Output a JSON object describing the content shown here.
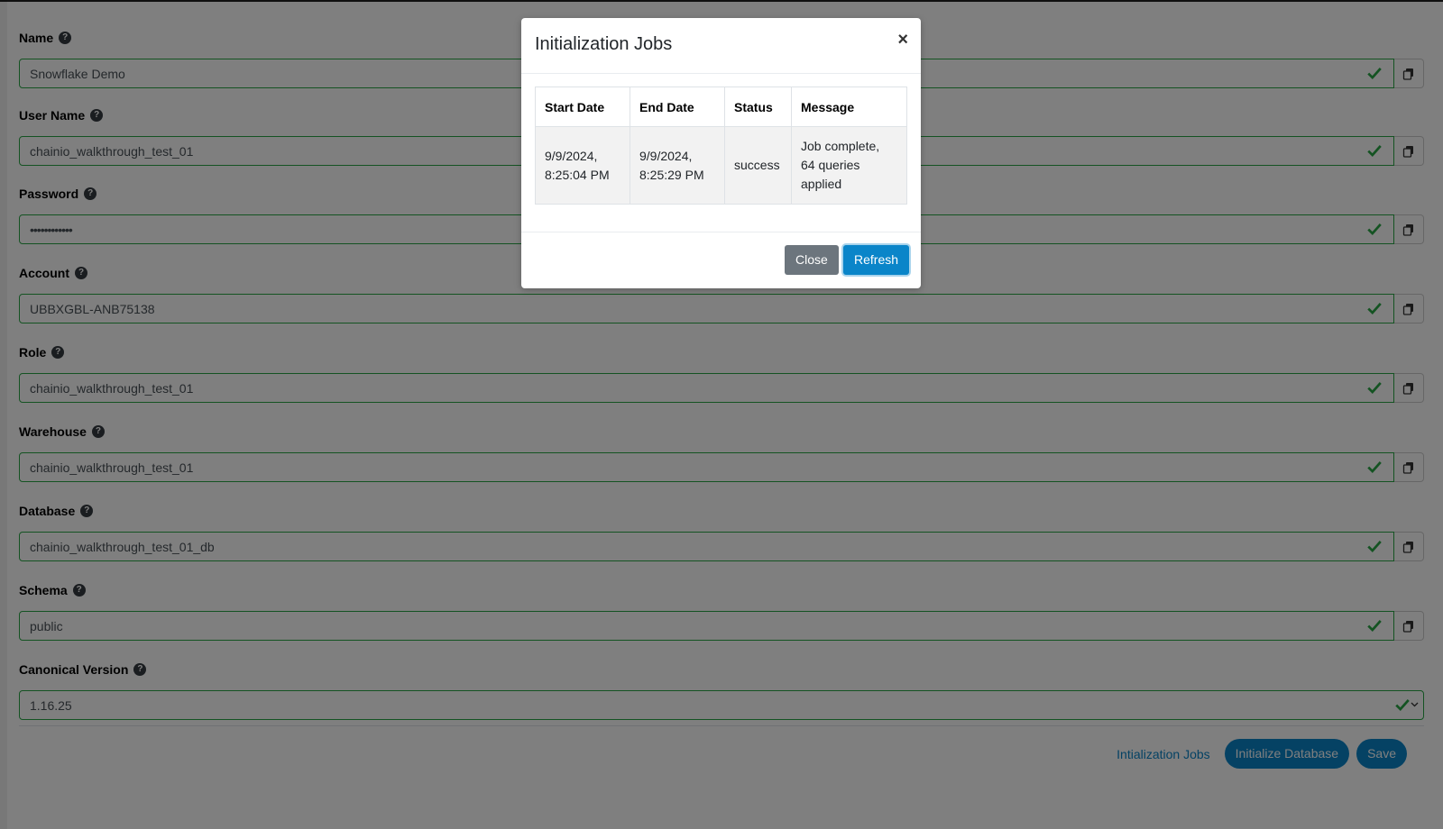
{
  "form": {
    "fields": [
      {
        "label": "Name",
        "value": "Snowflake Demo"
      },
      {
        "label": "User Name",
        "value": "chainio_walkthrough_test_01"
      },
      {
        "label": "Password",
        "value": "••••••••••••"
      },
      {
        "label": "Account",
        "value": "UBBXGBL-ANB75138"
      },
      {
        "label": "Role",
        "value": "chainio_walkthrough_test_01"
      },
      {
        "label": "Warehouse",
        "value": "chainio_walkthrough_test_01"
      },
      {
        "label": "Database",
        "value": "chainio_walkthrough_test_01_db"
      },
      {
        "label": "Schema",
        "value": "public"
      },
      {
        "label": "Canonical Version",
        "value": "1.16.25"
      }
    ],
    "help_glyph": "?",
    "actions": {
      "init_jobs_link": "Intialization Jobs",
      "init_db_button": "Initialize Database",
      "save_button": "Save"
    }
  },
  "modal": {
    "title": "Initialization Jobs",
    "close_glyph": "×",
    "table": {
      "headers": [
        "Start Date",
        "End Date",
        "Status",
        "Message"
      ],
      "rows": [
        {
          "start_date_line1": "9/9/2024,",
          "start_date_line2": "8:25:04 PM",
          "end_date_line1": "9/9/2024,",
          "end_date_line2": "8:25:29 PM",
          "status": "success",
          "message_line1": "Job complete,",
          "message_line2": "64 queries",
          "message_line3": "applied"
        }
      ]
    },
    "buttons": {
      "close": "Close",
      "refresh": "Refresh"
    }
  },
  "colors": {
    "valid": "#28a745",
    "primary": "#0a85c9",
    "secondary": "#6c757d",
    "overlay": "rgba(0,0,0,0.5)"
  },
  "icons": {
    "help": "question-circle-icon",
    "valid": "check-icon",
    "copy": "copy-icon",
    "close": "close-icon"
  }
}
